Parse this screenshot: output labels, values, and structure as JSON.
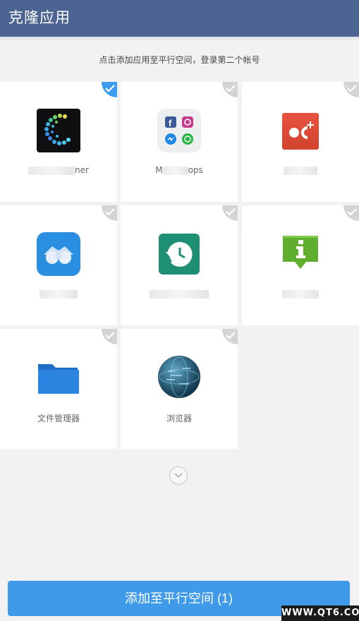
{
  "header": {
    "title": "克隆应用"
  },
  "hint": "点击添加应用至平行空间，登录第二个帐号",
  "apps": [
    {
      "label_visible": "ner",
      "checked": true,
      "icon": "cleaner-c-icon"
    },
    {
      "label_visible": "M",
      "label_visible_end": "ops",
      "checked": false,
      "icon": "messenger-apps-icon"
    },
    {
      "label_visible": "",
      "checked": false,
      "icon": "google-plus-icon"
    },
    {
      "label_visible": "",
      "checked": false,
      "icon": "binoculars-icon"
    },
    {
      "label_visible": "",
      "checked": false,
      "icon": "history-icon"
    },
    {
      "label_visible": "",
      "checked": false,
      "icon": "info-icon"
    },
    {
      "label": "文件管理器",
      "checked": false,
      "icon": "folder-icon"
    },
    {
      "label": "浏览器",
      "checked": false,
      "icon": "globe-icon"
    }
  ],
  "expand_icon": "chevron-down-icon",
  "add_button": "添加至平行空间 (1)",
  "watermark": "WWW.QT6.COM",
  "colors": {
    "header": "#4b6491",
    "accent": "#3f9bea",
    "check_on": "#3c9bf0"
  }
}
